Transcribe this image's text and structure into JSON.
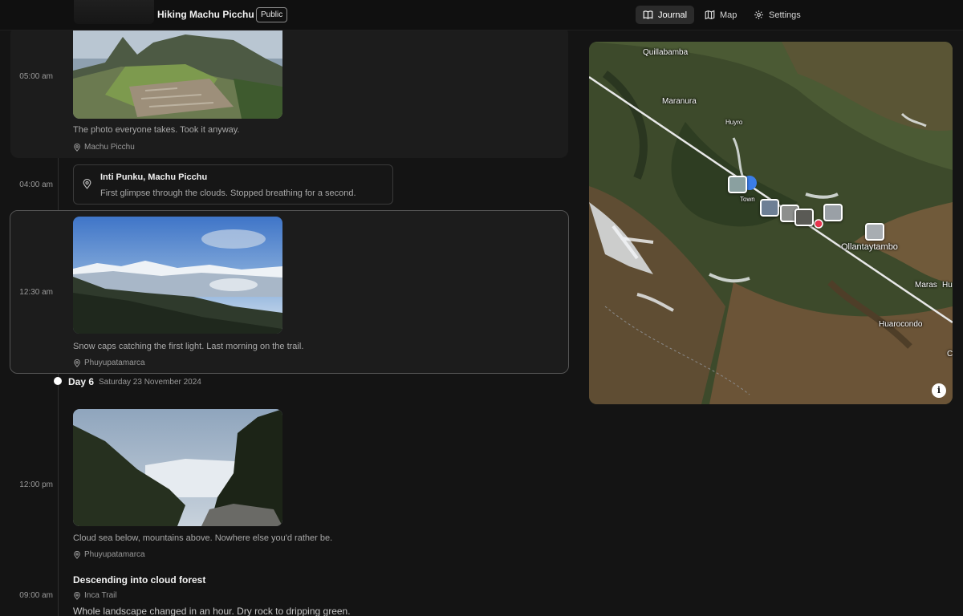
{
  "header": {
    "trip_title": "Hiking Machu Picchu",
    "visibility_badge": "Public",
    "tabs": [
      {
        "label": "Journal",
        "icon": "book-open-icon",
        "active": true
      },
      {
        "label": "Map",
        "icon": "map-icon",
        "active": false
      },
      {
        "label": "Settings",
        "icon": "gear-icon",
        "active": false
      }
    ]
  },
  "timeline": {
    "entries": [
      {
        "time": "05:00 am",
        "caption": "The photo everyone takes. Took it anyway.",
        "location": "Machu Picchu"
      },
      {
        "time": "04:00 am",
        "title": "Inti Punku, Machu Picchu",
        "text": "First glimpse through the clouds. Stopped breathing for a second."
      },
      {
        "time": "12:30 am",
        "caption": "Snow caps catching the first light. Last morning on the trail.",
        "location": "Phuyupatamarca"
      },
      {
        "time": "12:00 pm",
        "caption": "Cloud sea below, mountains above. Nowhere else you'd rather be.",
        "location": "Phuyupatamarca"
      },
      {
        "time": "09:00 am",
        "title": "Descending into cloud forest",
        "location": "Inca Trail",
        "text": "Whole landscape changed in an hour. Dry rock to dripping green."
      }
    ],
    "day_marker": {
      "label": "Day 6",
      "date": "Saturday 23 November 2024"
    }
  },
  "map": {
    "labels": {
      "quillabamba": "Quillabamba",
      "maranura": "Maranura",
      "huyro": "Huyro",
      "town": "Town",
      "ollantaytambo": "Ollantaytambo",
      "maras": "Maras",
      "hu": "Hu",
      "huarocondo": "Huarocondo",
      "c": "C"
    },
    "info_button": "i",
    "colors": {
      "route": "#e8e8e8",
      "current_pin": "#e8344e",
      "blue_pin": "#3b7de8"
    }
  }
}
